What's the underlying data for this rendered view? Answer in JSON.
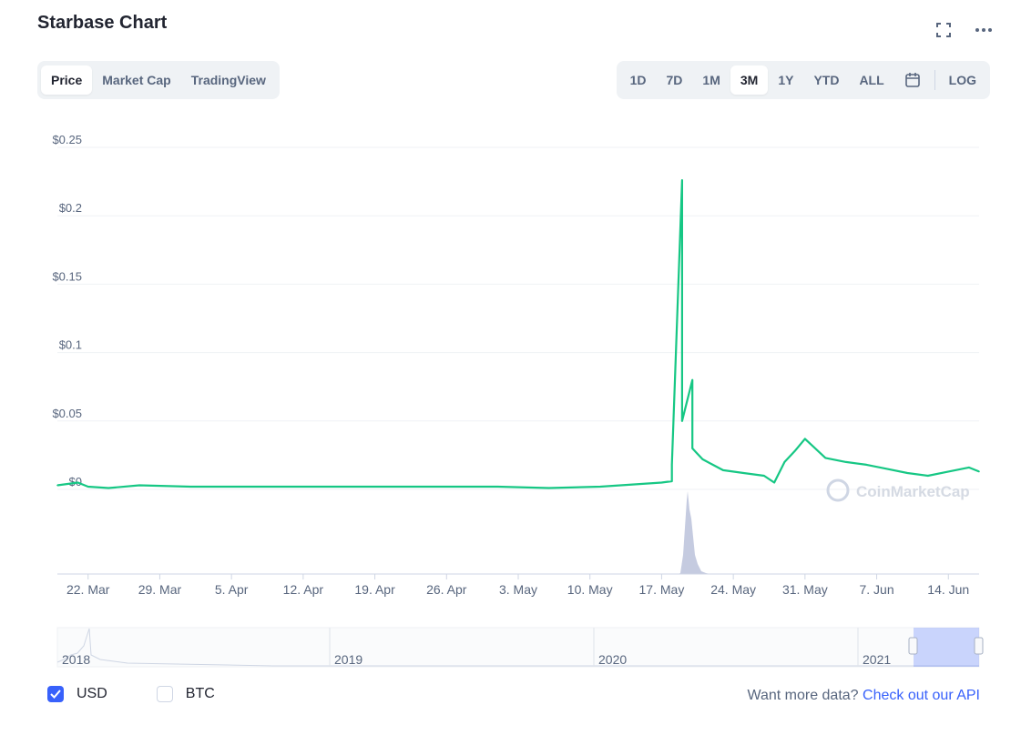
{
  "header": {
    "title": "Starbase Chart"
  },
  "tabs_left": [
    "Price",
    "Market Cap",
    "TradingView"
  ],
  "active_left": "Price",
  "tabs_right": [
    "1D",
    "7D",
    "1M",
    "3M",
    "1Y",
    "YTD",
    "ALL"
  ],
  "active_right": "3M",
  "log_label": "LOG",
  "icons": {
    "fullscreen": "fullscreen-icon",
    "more": "more-icon",
    "calendar": "calendar-icon"
  },
  "watermark": "CoinMarketCap",
  "currency": {
    "usd_label": "USD",
    "usd_checked": true,
    "btc_label": "BTC",
    "btc_checked": false
  },
  "api": {
    "prefix": "Want more data?",
    "link": "Check out our API"
  },
  "colors": {
    "price_line": "#16c784",
    "volume": "#c5cbe0",
    "accent": "#3861fb",
    "grid": "#eff2f5"
  },
  "chart_data": {
    "type": "line",
    "title": "Starbase Chart",
    "series_name": "Price",
    "y_unit": "USD",
    "y_ticks": [
      "$0.25",
      "$0.2",
      "$0.15",
      "$0.1",
      "$0.05",
      "$0"
    ],
    "ylim": [
      0,
      0.25
    ],
    "x_ticks": [
      "22. Mar",
      "29. Mar",
      "5. Apr",
      "12. Apr",
      "19. Apr",
      "26. Apr",
      "3. May",
      "10. May",
      "17. May",
      "24. May",
      "31. May",
      "7. Jun",
      "14. Jun"
    ],
    "x": [
      "2021-03-19",
      "2021-03-20",
      "2021-03-21",
      "2021-03-22",
      "2021-03-24",
      "2021-03-27",
      "2021-04-01",
      "2021-04-06",
      "2021-04-11",
      "2021-04-16",
      "2021-04-21",
      "2021-04-26",
      "2021-05-01",
      "2021-05-06",
      "2021-05-11",
      "2021-05-15",
      "2021-05-17",
      "2021-05-18",
      "2021-05-18",
      "2021-05-19",
      "2021-05-19",
      "2021-05-19",
      "2021-05-20",
      "2021-05-20",
      "2021-05-21",
      "2021-05-22",
      "2021-05-23",
      "2021-05-25",
      "2021-05-27",
      "2021-05-28",
      "2021-05-29",
      "2021-05-30",
      "2021-05-31",
      "2021-06-02",
      "2021-06-04",
      "2021-06-06",
      "2021-06-08",
      "2021-06-10",
      "2021-06-12",
      "2021-06-14",
      "2021-06-16",
      "2021-06-17"
    ],
    "y": [
      0.003,
      0.004,
      0.005,
      0.002,
      0.001,
      0.003,
      0.002,
      0.002,
      0.002,
      0.002,
      0.002,
      0.002,
      0.002,
      0.001,
      0.002,
      0.004,
      0.005,
      0.006,
      0.018,
      0.226,
      0.09,
      0.05,
      0.08,
      0.03,
      0.022,
      0.018,
      0.014,
      0.012,
      0.01,
      0.005,
      0.02,
      0.028,
      0.037,
      0.023,
      0.02,
      0.018,
      0.015,
      0.012,
      0.01,
      0.013,
      0.016,
      0.013
    ],
    "volume_note": "spike around 18–20 May",
    "navigator": {
      "labels": [
        "2018",
        "2019",
        "2020",
        "2021"
      ]
    }
  }
}
